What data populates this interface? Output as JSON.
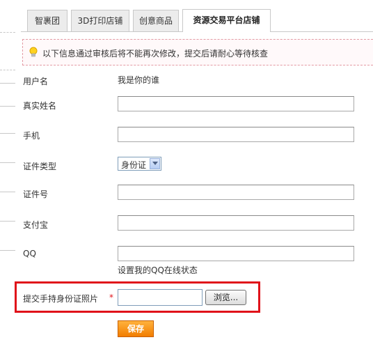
{
  "tabs": [
    {
      "label": "智裹团",
      "active": false
    },
    {
      "label": "3D打印店铺",
      "active": false
    },
    {
      "label": "创意商品",
      "active": false
    },
    {
      "label": "资源交易平台店铺",
      "active": true
    }
  ],
  "notice": {
    "icon": "lightbulb-icon",
    "text": "以下信息通过审核后将不能再次修改，提交后请耐心等待核查"
  },
  "form": {
    "username_label": "用户名",
    "username_value": "我是你的谁",
    "real_name_label": "真实姓名",
    "real_name_value": "",
    "phone_label": "手机",
    "phone_value": "",
    "id_type_label": "证件类型",
    "id_type_value": "身份证",
    "id_number_label": "证件号",
    "id_number_value": "",
    "alipay_label": "支付宝",
    "alipay_value": "",
    "qq_label": "QQ",
    "qq_value": "",
    "qq_hint": "设置我的QQ在线状态",
    "id_photo_label": "提交手持身份证照片",
    "required_mark": "*",
    "browse_label": "浏览...",
    "save_label": "保存"
  },
  "colors": {
    "highlight_border": "#e0121a",
    "save_button": "#f27d00",
    "notice_border": "#e39aa3"
  }
}
